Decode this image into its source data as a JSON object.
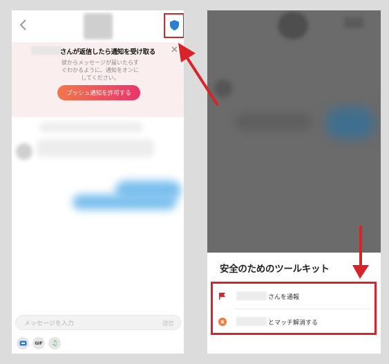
{
  "left_screen": {
    "banner": {
      "title": "さんが返信したら通知を受け取る",
      "description": "彼からメッセージが届いたらす\nぐわかるように、通知をオンに\nしてください。",
      "button_label": "プッシュ通知を許可する"
    },
    "input": {
      "placeholder": "メッセージを入力",
      "send_label": "送信"
    },
    "tools": {
      "gif_label": "GIF"
    }
  },
  "right_screen": {
    "sheet": {
      "heading": "安全のためのツールキット",
      "items": [
        {
          "label": "さんを通報",
          "icon": "flag-icon"
        },
        {
          "label": "とマッチ解消する",
          "icon": "unmatch-x-icon"
        }
      ]
    }
  },
  "colors": {
    "highlight_red": "#d8232a",
    "shield_blue": "#2f7fd0",
    "push_gradient_start": "#f2764a",
    "push_gradient_end": "#e8356b",
    "unmatch_orange": "#f07a3c"
  }
}
